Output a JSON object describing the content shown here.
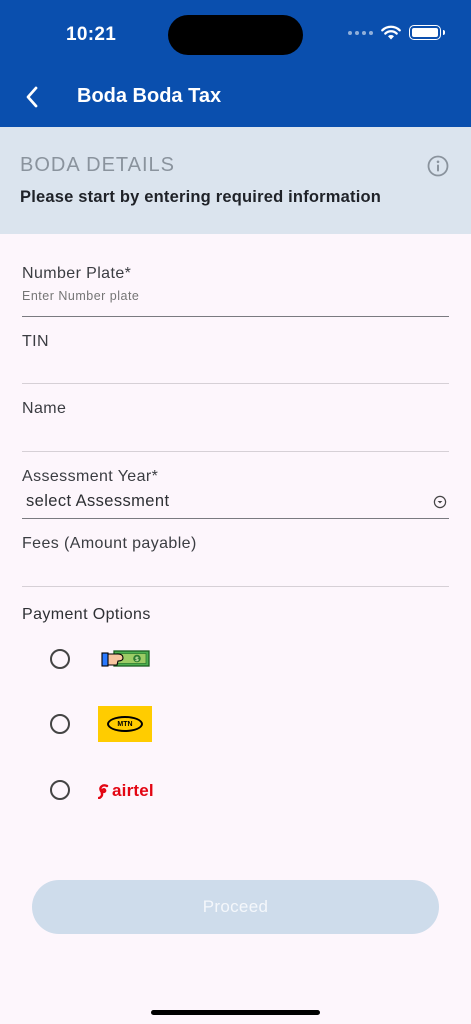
{
  "status_bar": {
    "time": "10:21"
  },
  "header": {
    "title": "Boda Boda Tax"
  },
  "section": {
    "heading": "BODA DETAILS",
    "subtitle": "Please start by entering required information"
  },
  "form": {
    "number_plate": {
      "label": "Number Plate*",
      "placeholder": "Enter Number plate",
      "value": ""
    },
    "tin": {
      "label": "TIN",
      "value": ""
    },
    "name": {
      "label": "Name",
      "value": ""
    },
    "assessment_year": {
      "label": "Assessment Year*",
      "selected": "select Assessment"
    },
    "fees": {
      "label": "Fees (Amount payable)",
      "value": ""
    }
  },
  "payment": {
    "label": "Payment Options",
    "options": [
      {
        "id": "cash",
        "icon": "cash-payment-icon",
        "selected": false
      },
      {
        "id": "mtn",
        "logo_text": "MTN",
        "selected": false
      },
      {
        "id": "airtel",
        "logo_text": "airtel",
        "selected": false
      }
    ]
  },
  "actions": {
    "proceed_label": "Proceed"
  },
  "colors": {
    "header_bg": "#0a4fae",
    "banner_bg": "#dbe4ee",
    "page_bg": "#fdf6fc",
    "button_disabled": "#cedceb",
    "mtn_yellow": "#ffcc00",
    "airtel_red": "#e30613"
  }
}
